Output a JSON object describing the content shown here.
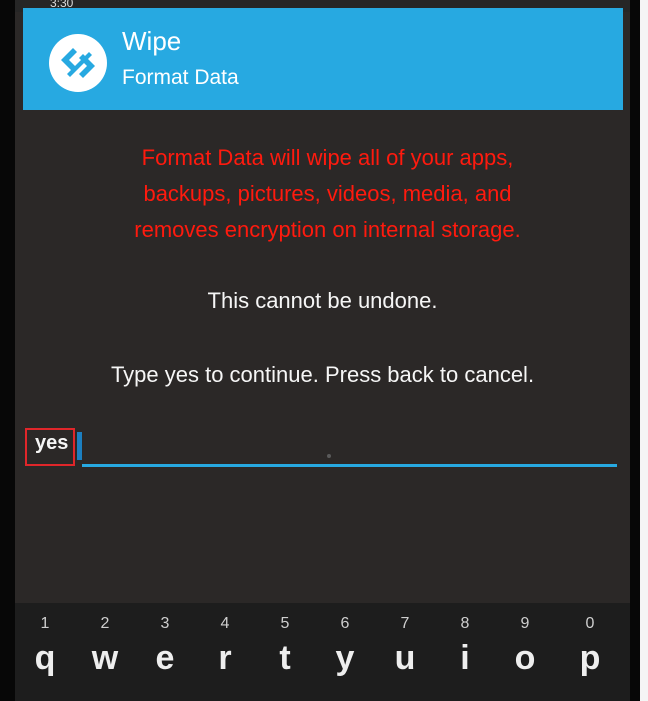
{
  "status_bar": {
    "time": "3:30"
  },
  "header": {
    "title": "Wipe",
    "subtitle": "Format Data",
    "logo_icon": "twrp-logo-icon"
  },
  "message": {
    "warning_lines": [
      "Format Data will wipe all of your apps,",
      "backups, pictures, videos, media, and",
      "removes encryption on internal storage."
    ],
    "line1": "This cannot be undone.",
    "line2": "Type yes to continue.  Press back to cancel."
  },
  "input": {
    "value": "yes"
  },
  "keyboard": {
    "keys": [
      {
        "num": "1",
        "ch": "q"
      },
      {
        "num": "2",
        "ch": "w"
      },
      {
        "num": "3",
        "ch": "e"
      },
      {
        "num": "4",
        "ch": "r"
      },
      {
        "num": "5",
        "ch": "t"
      },
      {
        "num": "6",
        "ch": "y"
      },
      {
        "num": "7",
        "ch": "u"
      },
      {
        "num": "8",
        "ch": "i"
      },
      {
        "num": "9",
        "ch": "o"
      },
      {
        "num": "0",
        "ch": "p"
      }
    ]
  },
  "colors": {
    "header": "#27a9e1",
    "warning": "#ff1a0e",
    "background": "#2b2827",
    "highlight": "#e0262a"
  }
}
